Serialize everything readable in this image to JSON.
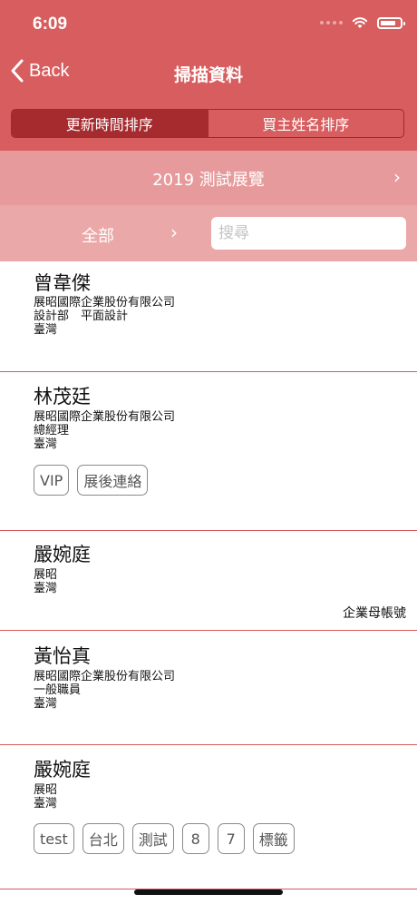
{
  "status": {
    "time": "6:09"
  },
  "nav": {
    "back_label": "Back",
    "title": "掃描資料"
  },
  "segments": [
    "更新時間排序",
    "買主姓名排序"
  ],
  "exhibition": {
    "label": "2019 測試展覽",
    "chevron": "›"
  },
  "filter": {
    "label": "全部",
    "chevron": "›"
  },
  "search": {
    "placeholder": "搜尋",
    "value": ""
  },
  "contacts": [
    {
      "name": "曾韋傑",
      "lines": [
        "展昭國際企業股份有限公司",
        "設計部　平面設計",
        "臺灣"
      ],
      "tags": []
    },
    {
      "name": "林茂廷",
      "lines": [
        "展昭國際企業股份有限公司",
        "總經理",
        "臺灣"
      ],
      "tags": [
        "VIP",
        "展後連絡"
      ]
    },
    {
      "name": "嚴婉庭",
      "lines": [
        "展昭",
        "臺灣"
      ],
      "tags": [],
      "note": "企業母帳號"
    },
    {
      "name": "黃怡真",
      "lines": [
        "展昭國際企業股份有限公司",
        "一般職員",
        "臺灣"
      ],
      "tags": []
    },
    {
      "name": "嚴婉庭",
      "lines": [
        "展昭",
        "臺灣"
      ],
      "tags": [
        "test",
        "台北",
        "測試",
        "8",
        "7",
        "標籤"
      ]
    }
  ],
  "colors": {
    "header": "#d75d5e",
    "segment_active": "#a52b2f",
    "exhibit_bar": "#e79a9b",
    "filter_bar": "#eba8a9",
    "divider": "#d7595b"
  }
}
